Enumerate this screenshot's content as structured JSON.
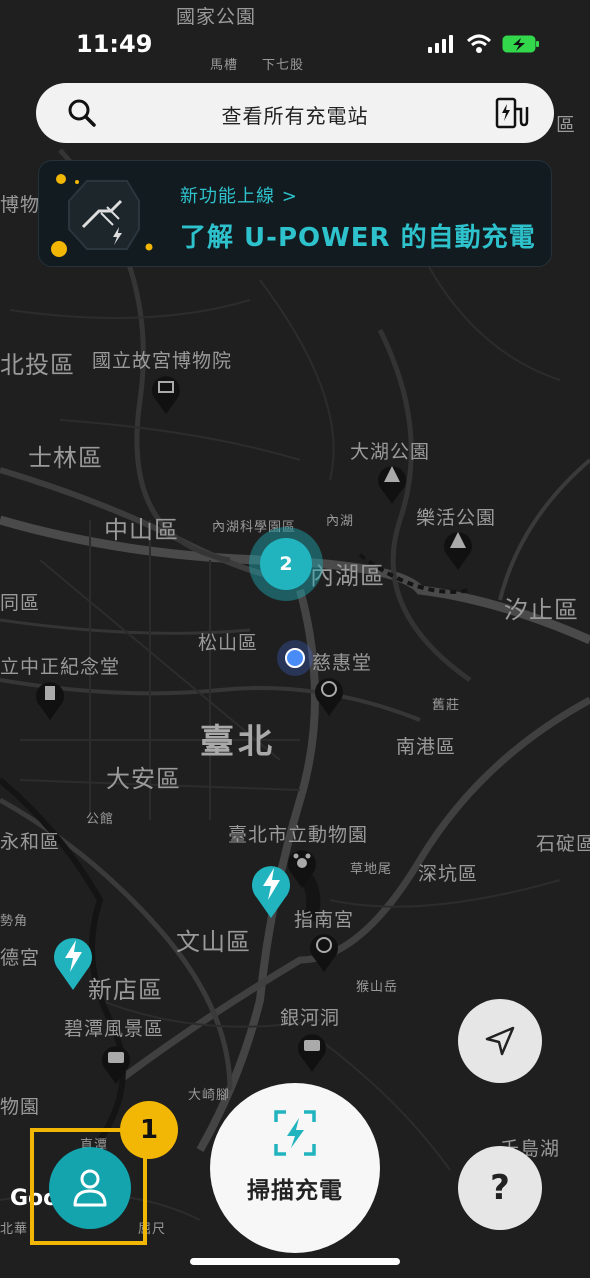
{
  "status_bar": {
    "time": "11:49"
  },
  "search": {
    "label": "查看所有充電站"
  },
  "banner": {
    "subtitle": "新功能上線 >",
    "title": "了解 U-POWER 的自動充電"
  },
  "map": {
    "labels": {
      "guojia_park": "國家公園",
      "macao": "馬槽",
      "xiagu": "下七股",
      "tl_qu": "區",
      "beitou_museum": "博物",
      "beitou": "北投區",
      "palace_museum": "國立故宮博物院",
      "shilin": "士林區",
      "dahu_park": "大湖公園",
      "neihu_sci": "內湖科學園區",
      "neihu_small": "內湖",
      "lehuo_park": "樂活公園",
      "zhongshan": "中山區",
      "neihu": "內湖區",
      "datong": "同區",
      "xizhi": "汐止區",
      "songshan": "松山區",
      "cihui_temple": "慈惠堂",
      "cks_memorial": "立中正紀念堂",
      "jiuzhuang": "舊莊",
      "taipei": "臺北",
      "nangang": "南港區",
      "daan": "大安區",
      "gongguan": "公館",
      "yonghe": "永和區",
      "taipei_zoo": "臺北市立動物園",
      "shiding": "石碇區",
      "caodiwei": "草地尾",
      "shenkeng": "深坑區",
      "shipai_jiao": "勢角",
      "zhinan_temple": "指南宮",
      "wenshan": "文山區",
      "de_temple": "德宮",
      "xindian": "新店區",
      "houshan_yue": "猴山岳",
      "yinhe_cave": "銀河洞",
      "bitan": "碧潭風景區",
      "wu_yuan": "物園",
      "daqijiao": "大崎腳",
      "qiandao_lake": "千島湖",
      "zhitan": "直潭",
      "beihua": "北華",
      "qu_chi": "屈尺"
    },
    "cluster_count": "2",
    "colors": {
      "background": "#1f1f1f",
      "road": "#3a3a3a",
      "accent": "#21b4bf"
    }
  },
  "controls": {
    "scan_label": "掃描充電",
    "help_label": "?",
    "step_badge": "1",
    "google": "Goo"
  },
  "icons": {
    "search": "search-icon",
    "charger": "charging-station-icon",
    "locate": "navigation-arrow-icon",
    "profile": "user-icon",
    "scan": "scan-bolt-icon"
  }
}
